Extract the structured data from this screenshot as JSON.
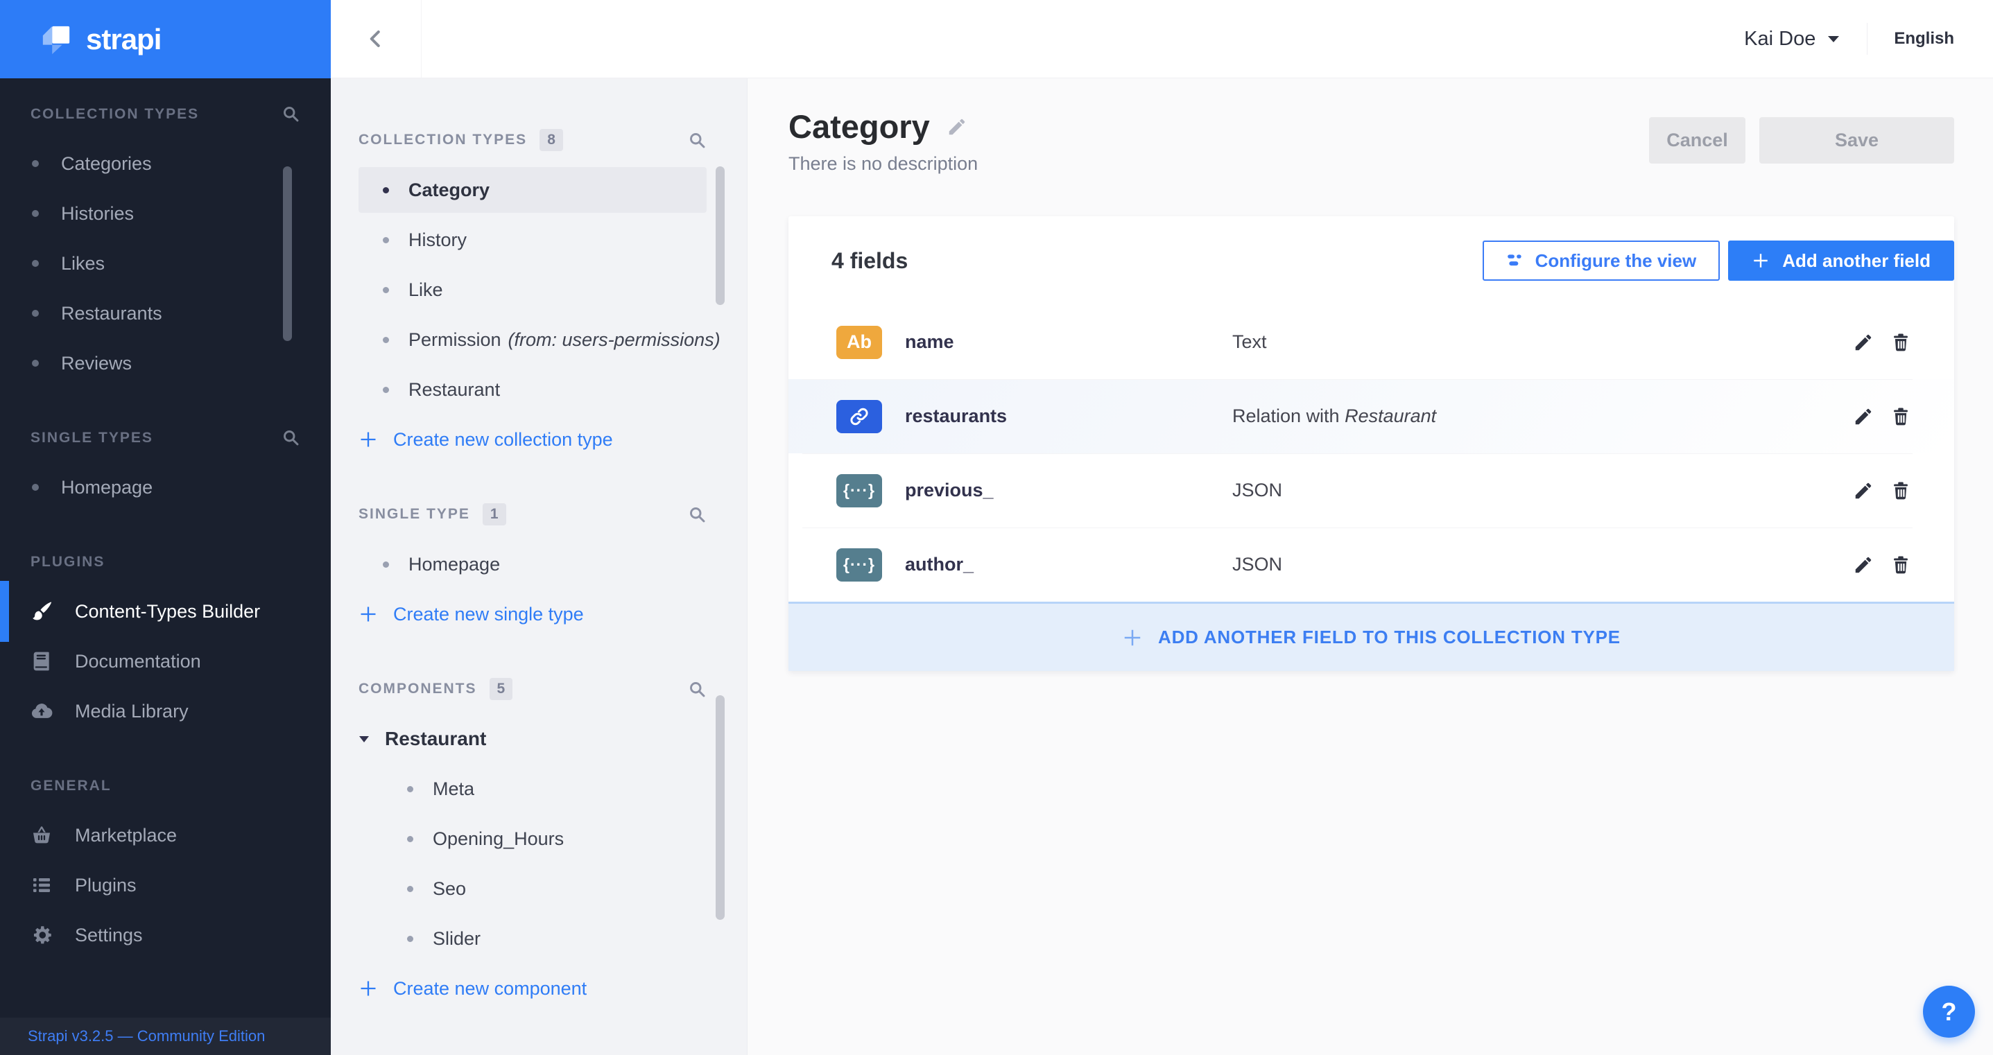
{
  "brand": {
    "name": "strapi",
    "footer": "Strapi v3.2.5 — Community Edition"
  },
  "topbar": {
    "user_name": "Kai Doe",
    "language": "English"
  },
  "nav": {
    "collection_types": {
      "title": "COLLECTION TYPES",
      "items": [
        "Categories",
        "Histories",
        "Likes",
        "Restaurants",
        "Reviews"
      ]
    },
    "single_types": {
      "title": "SINGLE TYPES",
      "items": [
        "Homepage"
      ]
    },
    "plugins": {
      "title": "PLUGINS",
      "items": [
        "Content-Types Builder",
        "Documentation",
        "Media Library"
      ]
    },
    "general": {
      "title": "GENERAL",
      "items": [
        "Marketplace",
        "Plugins",
        "Settings"
      ]
    }
  },
  "builder_nav": {
    "collection_types": {
      "title": "COLLECTION TYPES",
      "count": "8",
      "items": [
        {
          "label": "Category"
        },
        {
          "label": "History"
        },
        {
          "label": "Like"
        },
        {
          "label": "Permission",
          "suffix": "(from: users-permissions)"
        },
        {
          "label": "Restaurant"
        }
      ],
      "create_label": "Create new collection type"
    },
    "single_types": {
      "title": "SINGLE TYPE",
      "count": "1",
      "items": [
        {
          "label": "Homepage"
        }
      ],
      "create_label": "Create new single type"
    },
    "components": {
      "title": "COMPONENTS",
      "count": "5",
      "group_label": "Restaurant",
      "items": [
        {
          "label": "Meta"
        },
        {
          "label": "Opening_Hours"
        },
        {
          "label": "Seo"
        },
        {
          "label": "Slider"
        }
      ],
      "create_label": "Create new component"
    }
  },
  "content": {
    "title": "Category",
    "description": "There is no description",
    "cancel_label": "Cancel",
    "save_label": "Save",
    "fields_count": "4 fields",
    "configure_view_label": "Configure the view",
    "add_field_label": "Add another field",
    "footer_add_label": "ADD ANOTHER FIELD TO THIS COLLECTION TYPE",
    "help_label": "?",
    "rows": [
      {
        "icon_label": "Ab",
        "name": "name",
        "type": "Text"
      },
      {
        "name": "restaurants",
        "type_prefix": "Relation with",
        "type_italic": "Restaurant"
      },
      {
        "icon_label": "{···}",
        "name": "previous_",
        "type": "JSON"
      },
      {
        "icon_label": "{···}",
        "name": "author_",
        "type": "JSON"
      }
    ]
  },
  "colors": {
    "accent_blue": "#2d7ef7",
    "brand_header_blue": "#2d7cf7",
    "dark_sidebar_bg": "#1a202e",
    "light_sidebar_bg": "#f2f3f6",
    "text_field_icon_bg": "#efa83d",
    "relation_field_icon_bg": "#2b60df",
    "json_field_icon_bg": "#557e8e",
    "footer_band_bg": "#e4eefb",
    "footer_band_border": "#b7d4f8",
    "link_blue": "#2f7cf6"
  }
}
